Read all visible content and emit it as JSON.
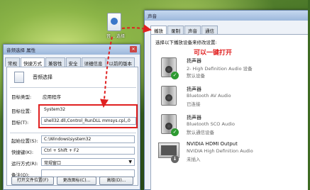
{
  "desktop_icon": {
    "label": "音… 选择"
  },
  "properties": {
    "title": "音频选择 属性",
    "tabs": [
      "常规",
      "快捷方式",
      "兼容性",
      "安全",
      "详细信息",
      "以前的版本"
    ],
    "app_name": "音频选择",
    "target_type_label": "目标类型:",
    "target_type_value": "应用程序",
    "target_location_label": "目标位置:",
    "target_location_value": "System32",
    "target_label": "目标(T):",
    "target_value": "shell32.dll,Control_RunDLL mmsys.cpl,,0",
    "start_in_label": "起始位置(S):",
    "start_in_value": "C:\\Windows\\system32",
    "hotkey_label": "快捷键(K):",
    "hotkey_value": "Ctrl + Shift + F2",
    "run_label": "运行方式(R):",
    "run_value": "常规窗口",
    "comment_label": "备注(O):",
    "comment_value": "",
    "btn_open_location": "打开文件位置(F)",
    "btn_change_icon": "更改图标(C)...",
    "btn_advanced": "高级(D)..."
  },
  "sound": {
    "title": "声音",
    "tabs": [
      "播放",
      "录制",
      "声音",
      "通信"
    ],
    "hint": "选择以下播放设备来修改设置:",
    "callout": "可以一键打开",
    "devices": [
      {
        "name": "扬声器",
        "desc": "2- High Definition Audio 设备",
        "status": "默认设备"
      },
      {
        "name": "扬声器",
        "desc": "Bluetooth AV Audio",
        "status": "已连接"
      },
      {
        "name": "扬声器",
        "desc": "Bluetooth SCO Audio",
        "status": "默认通信设备"
      },
      {
        "name": "NVIDIA HDMI Output",
        "desc": "NVIDIA High Definition Audio",
        "status": "未插入"
      }
    ]
  },
  "colors": {
    "highlight": "#e02020",
    "status_ok": "#2e9b32"
  }
}
